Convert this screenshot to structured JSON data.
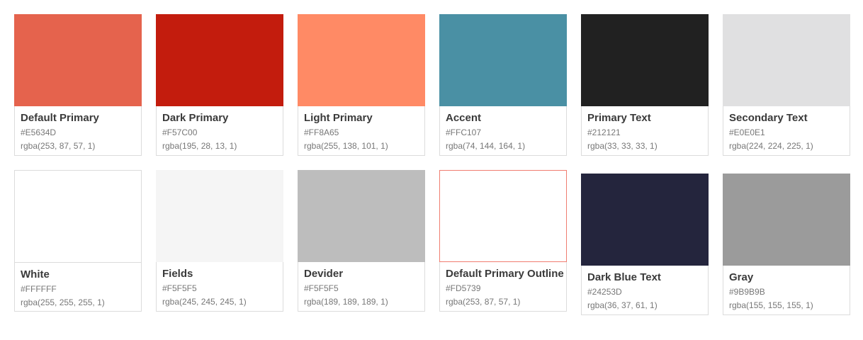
{
  "swatches": [
    {
      "name": "Default Primary",
      "hex": "#E5634D",
      "rgba": "rgba(253, 87, 57, 1)",
      "fill": "#E5634D"
    },
    {
      "name": "Dark Primary",
      "hex": "#F57C00",
      "rgba": "rgba(195, 28, 13, 1)",
      "fill": "#C31C0D"
    },
    {
      "name": "Light Primary",
      "hex": "#FF8A65",
      "rgba": "rgba(255, 138, 101, 1)",
      "fill": "#FF8A65"
    },
    {
      "name": "Accent",
      "hex": "#FFC107",
      "rgba": "rgba(74, 144, 164, 1)",
      "fill": "#4A90A4"
    },
    {
      "name": "Primary Text",
      "hex": "#212121",
      "rgba": "rgba(33, 33, 33, 1)",
      "fill": "#212121"
    },
    {
      "name": "Secondary Text",
      "hex": "#E0E0E1",
      "rgba": "rgba(224, 224, 225, 1)",
      "fill": "#E0E0E1"
    },
    {
      "name": "White",
      "hex": "#FFFFFF",
      "rgba": "rgba(255, 255, 255, 1)",
      "fill": "#FFFFFF"
    },
    {
      "name": "Fields",
      "hex": "#F5F5F5",
      "rgba": "rgba(245, 245, 245, 1)",
      "fill": "#F5F5F5"
    },
    {
      "name": "Devider",
      "hex": "#F5F5F5",
      "rgba": "rgba(189, 189, 189, 1)",
      "fill": "#BDBDBD"
    },
    {
      "name": "Default Primary Outline",
      "hex": "#FD5739",
      "rgba": "rgba(253, 87, 57, 1)",
      "fill": "#FFFFFF"
    },
    {
      "name": "Dark Blue Text",
      "hex": "#24253D",
      "rgba": "rgba(36, 37, 61, 1)",
      "fill": "#24253D"
    },
    {
      "name": "Gray",
      "hex": "#9B9B9B",
      "rgba": "rgba(155, 155, 155, 1)",
      "fill": "#9B9B9B"
    }
  ]
}
